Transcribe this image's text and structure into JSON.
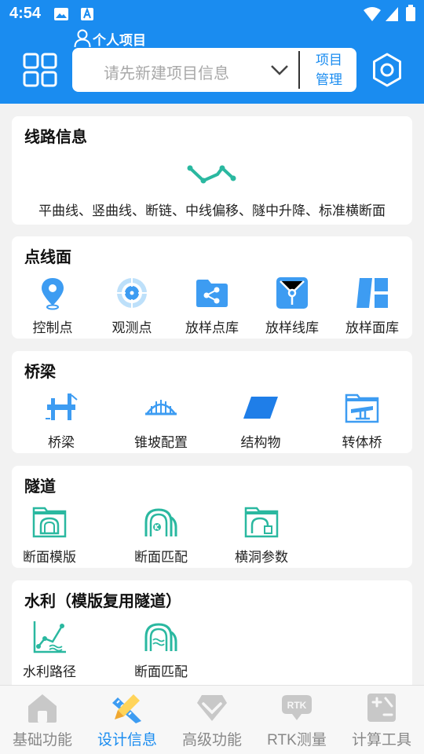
{
  "status": {
    "time": "4:54"
  },
  "header": {
    "project_label": "个人项目",
    "selector_placeholder": "请先新建项目信息",
    "project_manage_line1": "项目",
    "project_manage_line2": "管理"
  },
  "route": {
    "title": "线路信息",
    "description": "平曲线、竖曲线、断链、中线偏移、隧中升降、标准横断面"
  },
  "points": {
    "title": "点线面",
    "items": [
      {
        "label": "控制点",
        "icon": "location-pin-icon"
      },
      {
        "label": "观测点",
        "icon": "target-icon"
      },
      {
        "label": "放样点库",
        "icon": "share-folder-icon"
      },
      {
        "label": "放样线库",
        "icon": "line-box-icon"
      },
      {
        "label": "放样面库",
        "icon": "plane-blocks-icon"
      }
    ]
  },
  "bridge": {
    "title": "桥梁",
    "items": [
      {
        "label": "桥梁",
        "icon": "bridge-icon"
      },
      {
        "label": "锥坡配置",
        "icon": "suspension-bridge-icon"
      },
      {
        "label": "结构物",
        "icon": "parallelogram-icon"
      },
      {
        "label": "转体桥",
        "icon": "rotating-bridge-icon"
      }
    ]
  },
  "tunnel": {
    "title": "隧道",
    "items": [
      {
        "label": "断面模版",
        "icon": "tunnel-template-icon"
      },
      {
        "label": "断面匹配",
        "icon": "tunnel-match-icon"
      },
      {
        "label": "横洞参数",
        "icon": "tunnel-cross-icon"
      }
    ]
  },
  "water": {
    "title": "水利（模版复用隧道）",
    "items": [
      {
        "label": "水利路径",
        "icon": "water-path-icon"
      },
      {
        "label": "断面匹配",
        "icon": "water-match-icon"
      }
    ]
  },
  "nav": {
    "items": [
      {
        "label": "基础功能",
        "icon": "home-icon",
        "active": false
      },
      {
        "label": "设计信息",
        "icon": "pencil-ruler-icon",
        "active": true
      },
      {
        "label": "高级功能",
        "icon": "diamond-icon",
        "active": false
      },
      {
        "label": "RTK测量",
        "icon": "rtk-icon",
        "active": false
      },
      {
        "label": "计算工具",
        "icon": "calculator-icon",
        "active": false
      }
    ]
  },
  "colors": {
    "primary": "#1a8cf0",
    "accent": "#2ab8a0",
    "inactive": "#c8c8c8",
    "background": "#f2f2f2"
  }
}
